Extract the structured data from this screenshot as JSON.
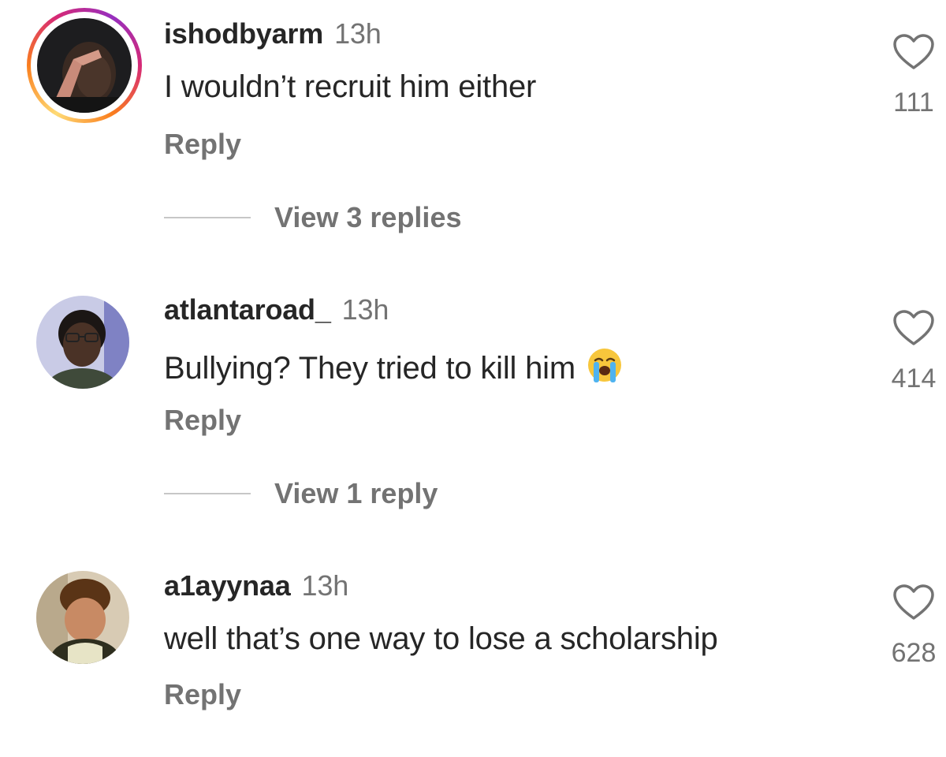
{
  "comments": [
    {
      "username": "ishodbyarm",
      "time": "13h",
      "text": "I wouldn’t recruit him either",
      "reply_label": "Reply",
      "view_replies_label": "View 3 replies",
      "likes": "111",
      "has_story_ring": true,
      "heart_icon": "heart-outline-icon"
    },
    {
      "username": "atlantaroad_",
      "time": "13h",
      "text": "Bullying? They tried to kill him",
      "emoji": "loudly-crying-face-emoji",
      "reply_label": "Reply",
      "view_replies_label": "View 1 reply",
      "likes": "414",
      "has_story_ring": false,
      "heart_icon": "heart-outline-icon"
    },
    {
      "username": "a1ayynaa",
      "time": "13h",
      "text": "well that’s one way to lose a scholarship",
      "reply_label": "Reply",
      "likes": "628",
      "has_story_ring": false,
      "heart_icon": "heart-outline-icon"
    }
  ],
  "colors": {
    "primary_text": "#262626",
    "secondary_text": "#737373",
    "divider": "#c7c7c7",
    "background": "#ffffff"
  }
}
